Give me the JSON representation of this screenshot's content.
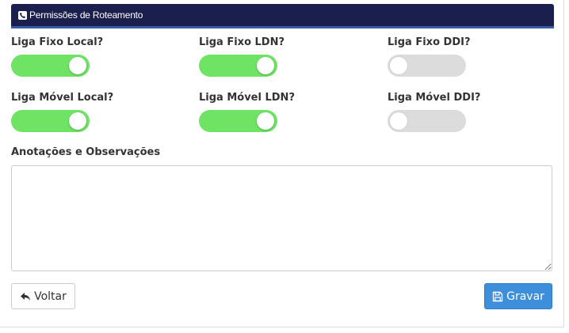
{
  "panel": {
    "title": "Permissões de Roteamento",
    "icon": "phone-icon",
    "header_color": "#1a1f4e"
  },
  "toggles": [
    {
      "id": "liga-fixo-local",
      "label": "Liga Fixo Local?",
      "on": true
    },
    {
      "id": "liga-fixo-ldn",
      "label": "Liga Fixo LDN?",
      "on": true
    },
    {
      "id": "liga-fixo-ddi",
      "label": "Liga Fixo DDI?",
      "on": false
    },
    {
      "id": "liga-movel-local",
      "label": "Liga Móvel Local?",
      "on": true
    },
    {
      "id": "liga-movel-ldn",
      "label": "Liga Móvel LDN?",
      "on": true
    },
    {
      "id": "liga-movel-ddi",
      "label": "Liga Móvel DDI?",
      "on": false
    }
  ],
  "toggle_colors": {
    "on": "#6ee364",
    "off": "#dcdcdc"
  },
  "notes": {
    "label": "Anotações e Observações",
    "value": ""
  },
  "buttons": {
    "back_label": "Voltar",
    "back_icon": "reply-arrow-icon",
    "save_label": "Gravar",
    "save_icon": "floppy-disk-icon",
    "save_color": "#3d8edb"
  }
}
